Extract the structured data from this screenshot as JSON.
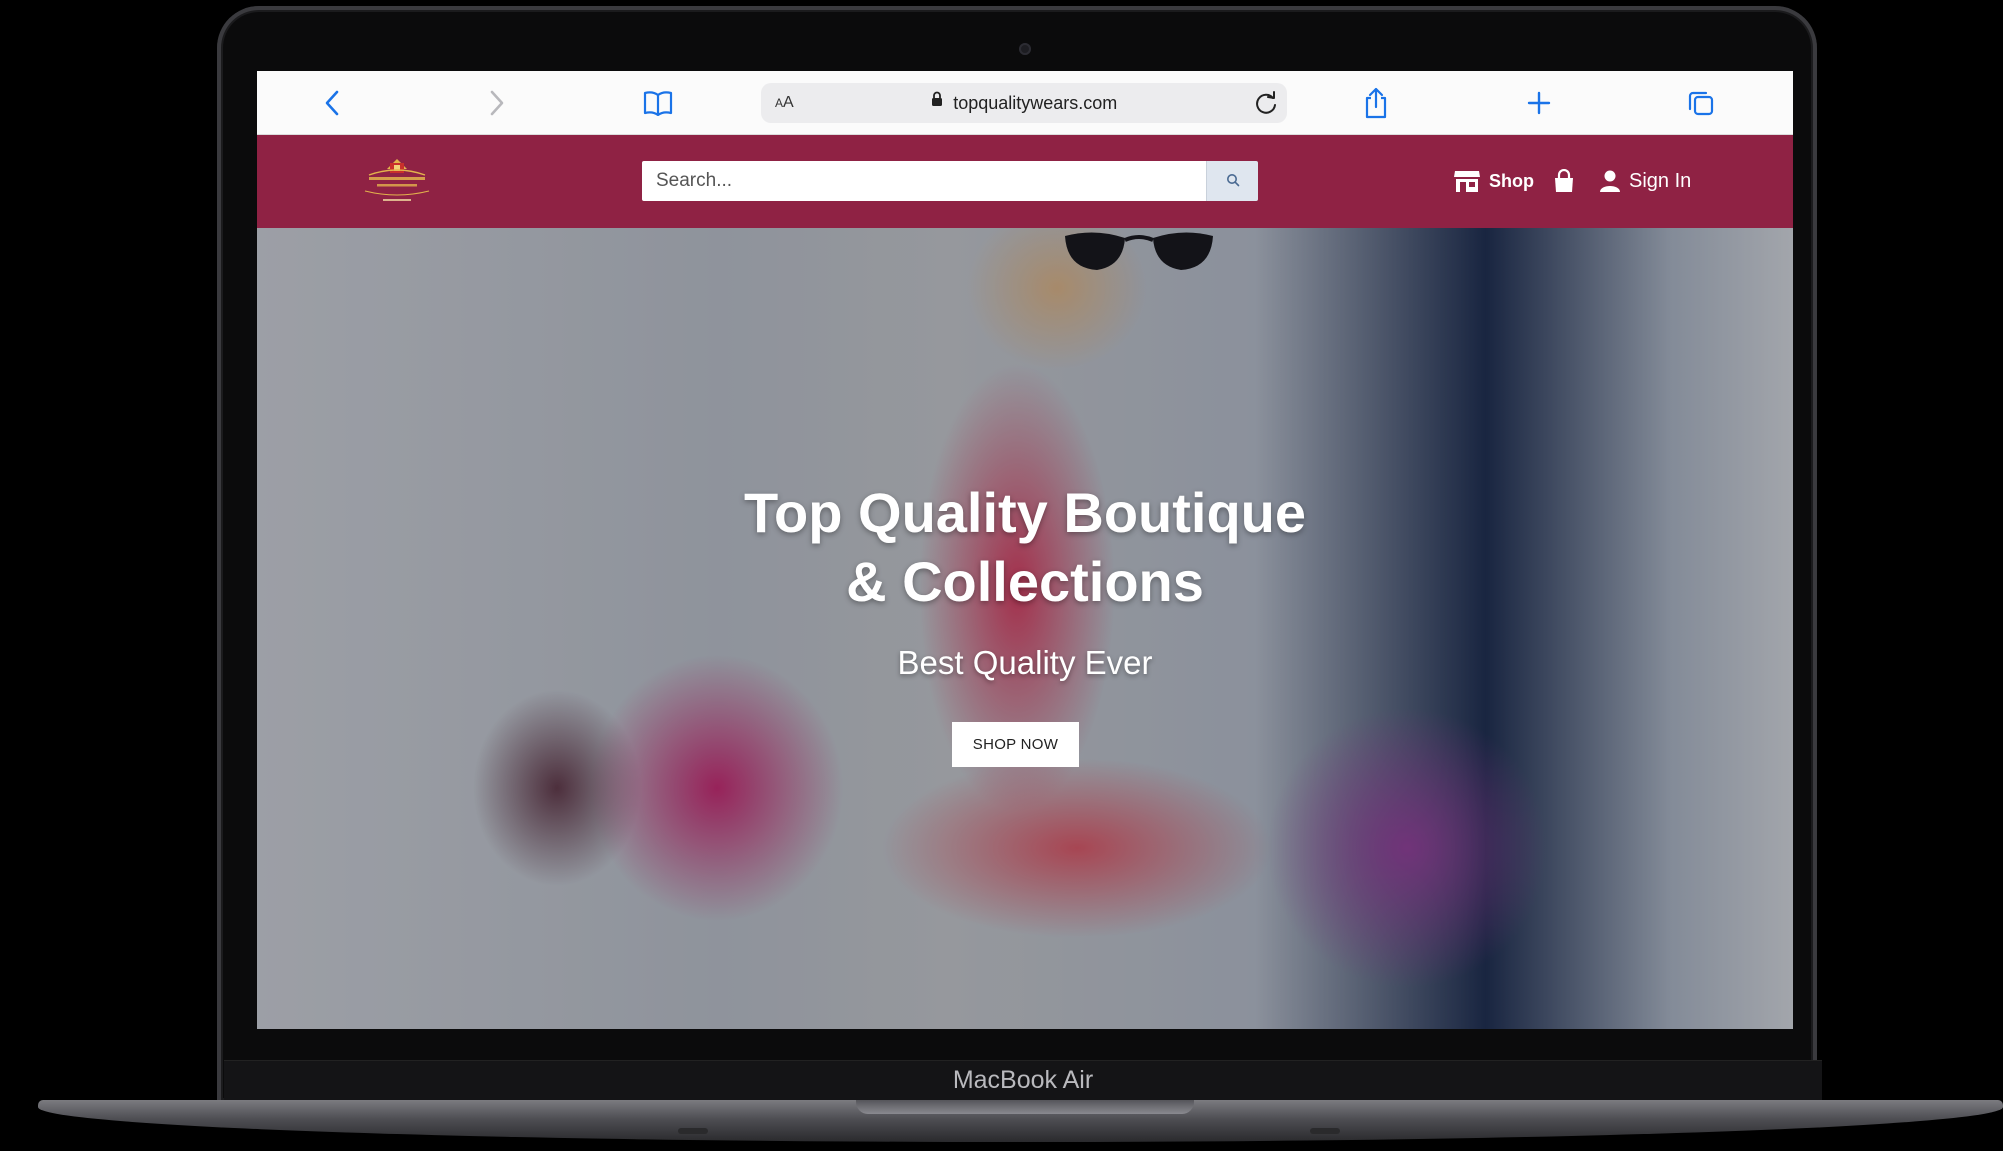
{
  "device": {
    "model_label": "MacBook Air"
  },
  "browser": {
    "aa_label": "AA",
    "url": "topqualitywears.com",
    "colors": {
      "accent": "#1a73e8"
    }
  },
  "site": {
    "colors": {
      "header_bg": "#8f2244"
    },
    "search": {
      "placeholder": "Search..."
    },
    "nav": {
      "shop_label": "Shop",
      "signin_label": "Sign In"
    },
    "hero": {
      "title_line1": "Top Quality Boutique",
      "title_line2": "& Collections",
      "subtitle": "Best Quality Ever",
      "cta_label": "SHOP NOW"
    }
  }
}
